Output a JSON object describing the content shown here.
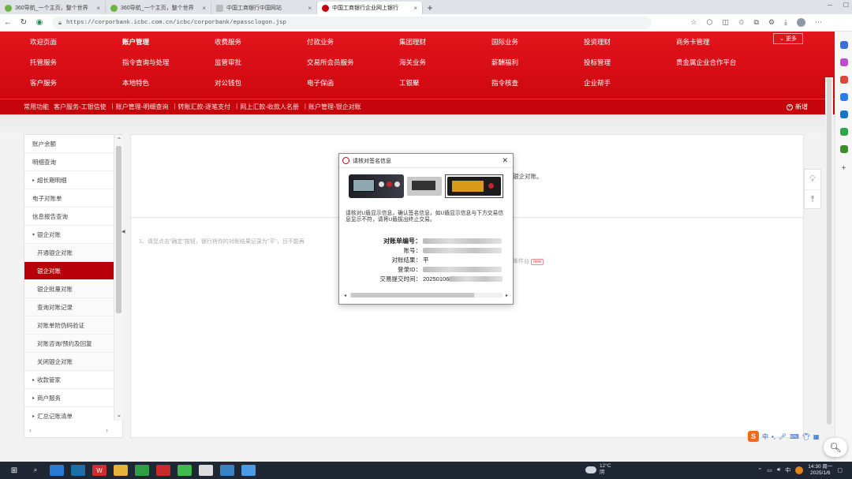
{
  "browser": {
    "tabs": [
      {
        "title": "360导航_一个主页，整个世界",
        "active": false,
        "icon": "globe-icon"
      },
      {
        "title": "360导航_一个主页，整个世界",
        "active": false,
        "icon": "globe-icon"
      },
      {
        "title": "中国工商银行中国网站",
        "active": false,
        "icon": "doc-icon"
      },
      {
        "title": "中国工商银行企业网上银行",
        "active": true,
        "icon": "icbc-icon"
      }
    ],
    "url": "https://corporbank.icbc.com.cn/icbc/corporbank/epassclogon.jsp"
  },
  "header": {
    "menu_rows": [
      [
        "欢迎页面",
        "账户管理",
        "收费服务",
        "付款业务",
        "集团理财",
        "国际业务",
        "投资理财",
        "商务卡管理"
      ],
      [
        "托管服务",
        "指令查询与处理",
        "监管审批",
        "交易所会员服务",
        "海关业务",
        "薪酬福利",
        "投标管理",
        "贵金属企业合作平台"
      ],
      [
        "客户服务",
        "本地特色",
        "对公钱包",
        "电子保函",
        "工银聚",
        "指令核查",
        "企业帮手"
      ]
    ],
    "active_menu": "账户管理",
    "more_label": "更多",
    "common_label": "常用功能",
    "common_links": [
      "客户服务-工银信使",
      "账户管理-明细查询",
      "转账汇款-逐笔支付",
      "网上汇款-收款人名册",
      "账户管理-银企对账"
    ],
    "new_label": "新增"
  },
  "sidebar": {
    "items": [
      {
        "label": "账户余额",
        "type": "item"
      },
      {
        "label": "明细查询",
        "type": "item"
      },
      {
        "label": "超长期明细",
        "type": "group"
      },
      {
        "label": "电子对账单",
        "type": "item"
      },
      {
        "label": "信息报告查询",
        "type": "item"
      },
      {
        "label": "银企对账",
        "type": "group-open"
      },
      {
        "label": "开通银企对账",
        "type": "sub"
      },
      {
        "label": "银企对账",
        "type": "sub-active"
      },
      {
        "label": "银企批量对账",
        "type": "sub"
      },
      {
        "label": "查询对账记录",
        "type": "sub"
      },
      {
        "label": "对账单防伪码验证",
        "type": "sub"
      },
      {
        "label": "对账咨询/预约及回复",
        "type": "sub"
      },
      {
        "label": "关闭银企对账",
        "type": "sub"
      },
      {
        "label": "收款管家",
        "type": "group"
      },
      {
        "label": "商户服务",
        "type": "group"
      },
      {
        "label": "汇总记账清单",
        "type": "group"
      }
    ]
  },
  "content": {
    "behind_text_1": "银企对账。",
    "tips": "1、请您点击\"确定\"按钮，银行将你的对账结果记录为\"平\"，且不能再",
    "behind_text_2": "邮件台",
    "behind_badge": "new"
  },
  "dialog": {
    "title": "请核对签名信息",
    "message": "请核对U盾显示信息，确认签名信息，如U盾显示信息与下方交易信息显示不符，请将U盾拔出终止交易。",
    "fields": [
      {
        "label": "对账单编号：",
        "value": "",
        "blurred": true,
        "strong": true
      },
      {
        "label": "账号：",
        "value": "",
        "blurred": true
      },
      {
        "label": "对账结果：",
        "value": "平",
        "blurred": false
      },
      {
        "label": "登录ID：",
        "value": "",
        "blurred": true
      },
      {
        "label": "交易提交时间：",
        "value": "20250106",
        "blurred": true
      }
    ]
  },
  "taskbar": {
    "weather_temp": "12°C",
    "weather_desc": "阴",
    "time": "14:30 周一",
    "date": "2025/1/6",
    "ime_label": "中"
  },
  "colors": {
    "brand_red": "#c7000b",
    "header_red": "#e3141c"
  }
}
